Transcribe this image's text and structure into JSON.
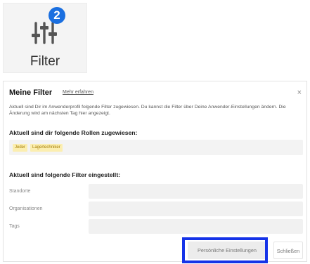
{
  "filter_tile": {
    "badge_count": "2",
    "label": "Filter",
    "icon": "sliders-icon",
    "badge_color": "#1a6fe0"
  },
  "modal": {
    "title": "Meine Filter",
    "learn_more": "Mehr erfahren",
    "close_symbol": "×",
    "description": "Aktuell sind Dir im Anwenderprofil folgende Filter zugewiesen. Du kannst die Filter über Deine Anwender-Einstellungen ändern. Die Änderung wird am nächsten Tag hier angezeigt.",
    "roles_heading": "Aktuell sind dir folgende Rollen zugewiesen:",
    "roles": [
      "Jeder",
      "Lagertechniker"
    ],
    "filters_heading": "Aktuell sind folgende Filter eingestellt:",
    "filters": [
      {
        "label": "Standorte",
        "value": ""
      },
      {
        "label": "Organisationen",
        "value": ""
      },
      {
        "label": "Tags",
        "value": ""
      }
    ],
    "buttons": {
      "personal_settings": "Persönliche Einstellungen",
      "close": "Schließen"
    },
    "colors": {
      "tag_background": "#fbeeb0",
      "tag_text": "#a37b00",
      "highlight": "#1533e8"
    }
  }
}
